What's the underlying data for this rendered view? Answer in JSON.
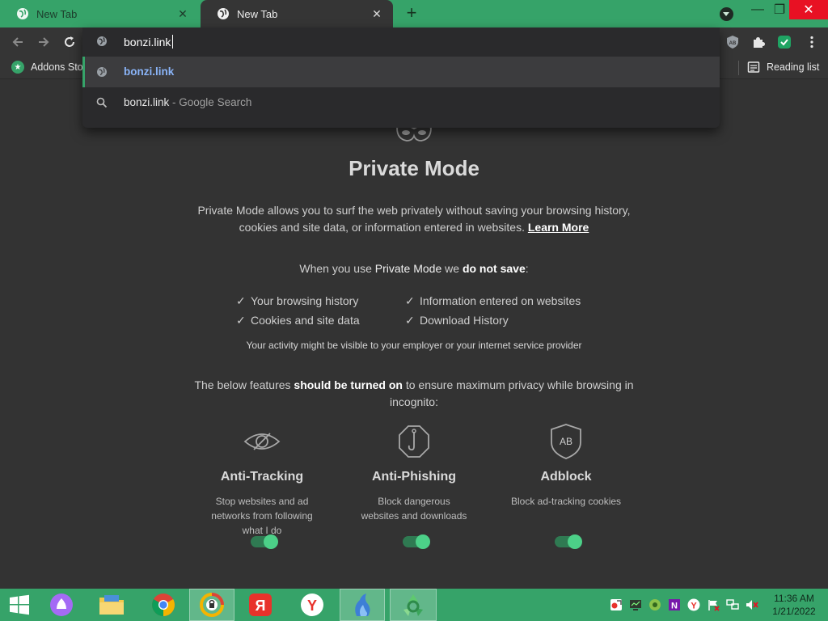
{
  "tabs": [
    {
      "title": "New Tab",
      "active": false
    },
    {
      "title": "New Tab",
      "active": true
    }
  ],
  "window_controls": {
    "minimize": "—",
    "maximize": "❐",
    "close": "✕"
  },
  "omnibox": {
    "input_value": "bonzi.link",
    "suggestions": [
      {
        "icon": "globe-icon",
        "text": "bonzi.link"
      },
      {
        "icon": "search-icon",
        "query": "bonzi.link",
        "separator": " - ",
        "provider": "Google Search"
      }
    ]
  },
  "bookmarks": {
    "items": [
      {
        "label": "Addons Stor",
        "icon": "addons-store-icon"
      }
    ],
    "reading_list": "Reading list"
  },
  "private_page": {
    "title": "Private Mode",
    "description": "Private Mode allows you to surf the web privately without saving your browsing history, cookies and site data, or information entered in websites.",
    "learn_more": "Learn More",
    "when_prefix": "When you use ",
    "when_mode": "Private Mode",
    "when_middle": " we ",
    "when_not_save": "do not save",
    "when_suffix": ":",
    "not_saved": [
      "Your browsing history",
      "Cookies and site data",
      "Information entered on websites",
      "Download History"
    ],
    "visibility_note": "Your activity might be visible to your employer or your internet service provider",
    "below_prefix": "The below features ",
    "below_strong": "should be turned on",
    "below_suffix": " to ensure maximum privacy while browsing in incognito:",
    "features": [
      {
        "title": "Anti-Tracking",
        "description": "Stop websites and ad networks from following what I do",
        "enabled": true
      },
      {
        "title": "Anti-Phishing",
        "description": "Block dangerous websites and downloads",
        "enabled": true
      },
      {
        "title": "Adblock",
        "description": "Block ad-tracking cookies",
        "enabled": true,
        "badge": "AB"
      }
    ]
  },
  "taskbar": {
    "time": "11:36 AM",
    "date": "1/21/2022"
  },
  "colors": {
    "accent": "#36a369",
    "page_bg": "#333333",
    "toggle_on": "#4cd088",
    "link": "#8ab4f8"
  }
}
